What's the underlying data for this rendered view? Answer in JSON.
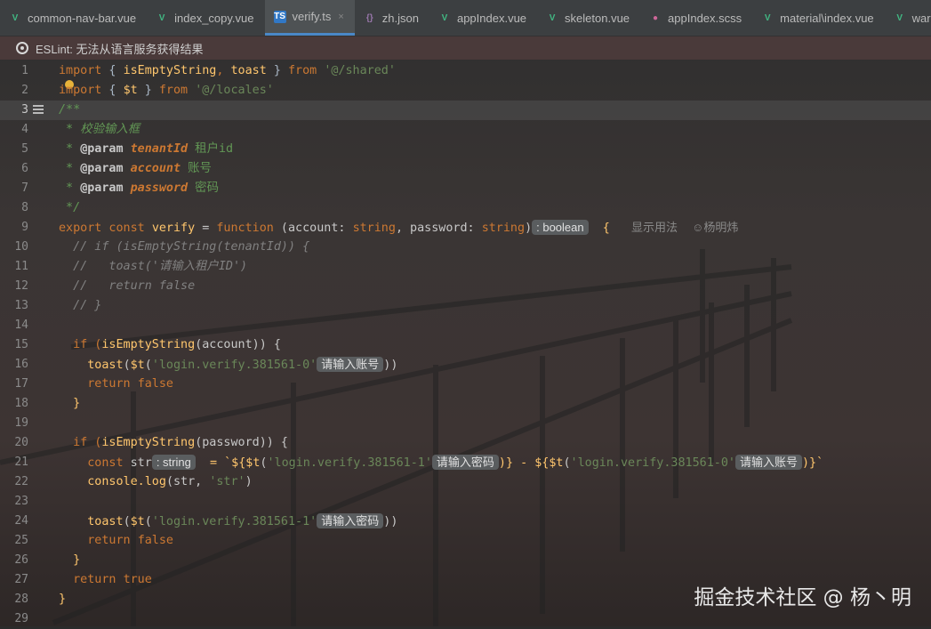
{
  "tabs": [
    {
      "label": "common-nav-bar.vue",
      "icon": "vue-icon",
      "active": false
    },
    {
      "label": "index_copy.vue",
      "icon": "vue-icon",
      "active": false
    },
    {
      "label": "verify.ts",
      "icon": "typescript-icon",
      "active": true,
      "close": "×"
    },
    {
      "label": "zh.json",
      "icon": "json-icon",
      "active": false
    },
    {
      "label": "appIndex.vue",
      "icon": "vue-icon",
      "active": false
    },
    {
      "label": "skeleton.vue",
      "icon": "vue-icon",
      "active": false
    },
    {
      "label": "appIndex.scss",
      "icon": "scss-icon",
      "active": false
    },
    {
      "label": "material\\index.vue",
      "icon": "vue-icon",
      "active": false
    },
    {
      "label": "warranty\\inde",
      "icon": "vue-icon",
      "active": false
    }
  ],
  "banner": {
    "text": "ESLint: 无法从语言服务获得结果"
  },
  "lines": [
    "1",
    "2",
    "3",
    "4",
    "5",
    "6",
    "7",
    "8",
    "9",
    "10",
    "11",
    "12",
    "13",
    "14",
    "15",
    "16",
    "17",
    "18",
    "19",
    "20",
    "21",
    "22",
    "23",
    "24",
    "25",
    "26",
    "27",
    "28",
    "29"
  ],
  "current_line": "3",
  "code": {
    "l1": {
      "a": "import",
      "b": " { ",
      "c": "isEmptyString",
      "d": ", ",
      "e": "toast",
      "f": " } ",
      "g": "from",
      "h": " ",
      "i": "'@/shared'"
    },
    "l2": {
      "a": "import",
      "b": " { ",
      "c": "$t",
      "d": " } ",
      "e": "from",
      "f": " ",
      "g": "'@/locales'"
    },
    "l3": "/**",
    "l4": " * 校验输入框",
    "l5": {
      "star": " * ",
      "tag": "@param",
      "sp": " ",
      "param": "tenantId",
      "txt": " 租户id"
    },
    "l6": {
      "star": " * ",
      "tag": "@param",
      "sp": " ",
      "param": "account",
      "txt": " 账号"
    },
    "l7": {
      "star": " * ",
      "tag": "@param",
      "sp": " ",
      "param": "password",
      "txt": " 密码"
    },
    "l8": " */",
    "l9": {
      "export": "export",
      "const": " const ",
      "name": "verify",
      "eq": " = ",
      "func": "function",
      "p1": " (account: ",
      "t1": "string",
      "p2": ", password: ",
      "t2": "string",
      "p3": ")",
      "hint": ": boolean",
      "brace": "  {",
      "lens1": "显示用法",
      "lens2": "杨明炜"
    },
    "l10": "  // if (isEmptyString(tenantId)) {",
    "l11": "  //   toast('请输入租户ID')",
    "l12": "  //   return false",
    "l13": "  // }",
    "l15": {
      "a": "  if (",
      "b": "isEmptyString",
      "c": "(account)) {"
    },
    "l16": {
      "a": "    ",
      "b": "toast",
      "c": "(",
      "d": "$t",
      "e": "(",
      "f": "'login.verify.381561-0'",
      "hint": "请输入账号",
      "g": "))"
    },
    "l17": {
      "a": "    ",
      "b": "return",
      "c": " ",
      "d": "false"
    },
    "l18": "  }",
    "l20": {
      "a": "  if (",
      "b": "isEmptyString",
      "c": "(password)) {"
    },
    "l21": {
      "a": "    ",
      "b": "const",
      "c": " str",
      "hint1": ": string",
      "d": "  = `${",
      "e": "$t",
      "f": "(",
      "g": "'login.verify.381561-1'",
      "hint2": "请输入密码",
      "h": ")} - ${",
      "i": "$t",
      "j": "(",
      "k": "'login.verify.381561-0'",
      "hint3": "请输入账号",
      "l": ")}`"
    },
    "l22": {
      "a": "    console.",
      "b": "log",
      "c": "(str, ",
      "d": "'str'",
      "e": ")"
    },
    "l24": {
      "a": "    ",
      "b": "toast",
      "c": "(",
      "d": "$t",
      "e": "(",
      "f": "'login.verify.381561-1'",
      "hint": "请输入密码",
      "g": "))"
    },
    "l25": {
      "a": "    ",
      "b": "return",
      "c": " ",
      "d": "false"
    },
    "l26": "  }",
    "l27": {
      "a": "  ",
      "b": "return",
      "c": " ",
      "d": "true"
    },
    "l28": "}"
  },
  "watermark": "掘金技术社区 @ 杨丶明"
}
